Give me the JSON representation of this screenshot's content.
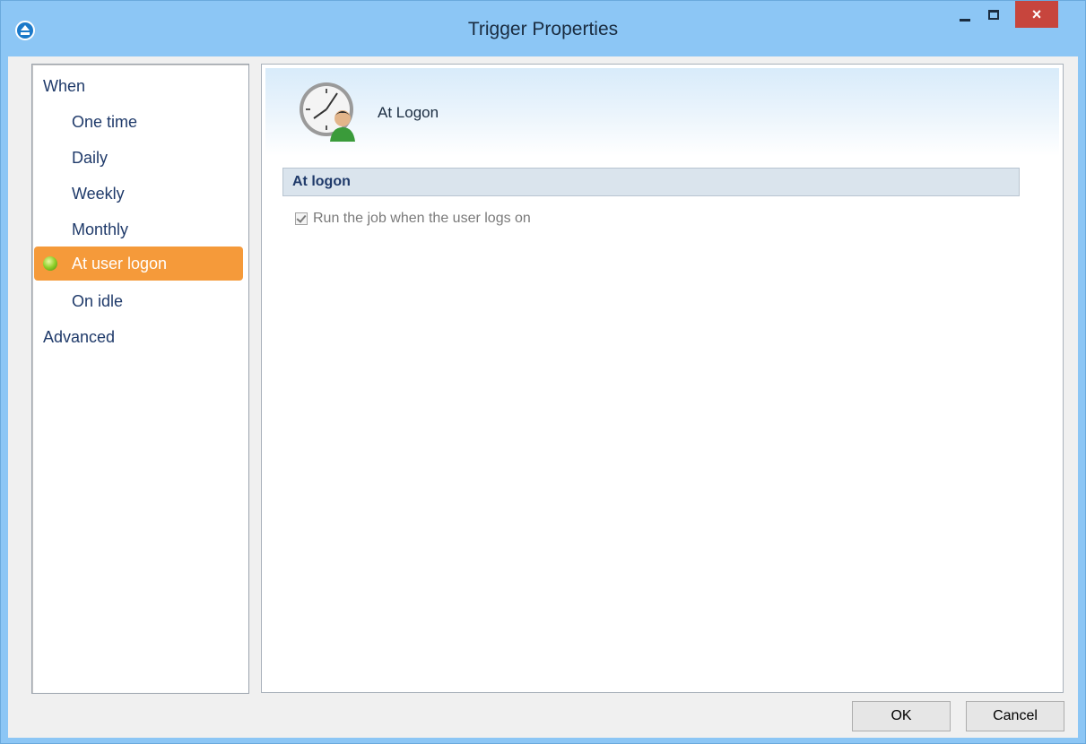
{
  "window": {
    "title": "Trigger Properties",
    "close_glyph": "×"
  },
  "sidebar": {
    "items": [
      {
        "label": "When",
        "level": 0
      },
      {
        "label": "One time",
        "level": 1
      },
      {
        "label": "Daily",
        "level": 1
      },
      {
        "label": "Weekly",
        "level": 1
      },
      {
        "label": "Monthly",
        "level": 1
      },
      {
        "label": "At user logon",
        "level": 1,
        "selected": true,
        "icon": "green-bullet-icon"
      },
      {
        "label": "On idle",
        "level": 1
      },
      {
        "label": "Advanced",
        "level": 0
      }
    ]
  },
  "main": {
    "header_title": "At Logon",
    "header_icon": "clock-user-icon",
    "section_title": "At logon",
    "checkbox": {
      "label": "Run the job when the user logs on",
      "checked": true,
      "disabled": true
    }
  },
  "footer": {
    "ok_label": "OK",
    "cancel_label": "Cancel"
  },
  "colors": {
    "titlebar": "#8cc6f5",
    "selected_item": "#f59a3a",
    "close_button": "#c7453d",
    "section_header": "#dae4ed"
  }
}
